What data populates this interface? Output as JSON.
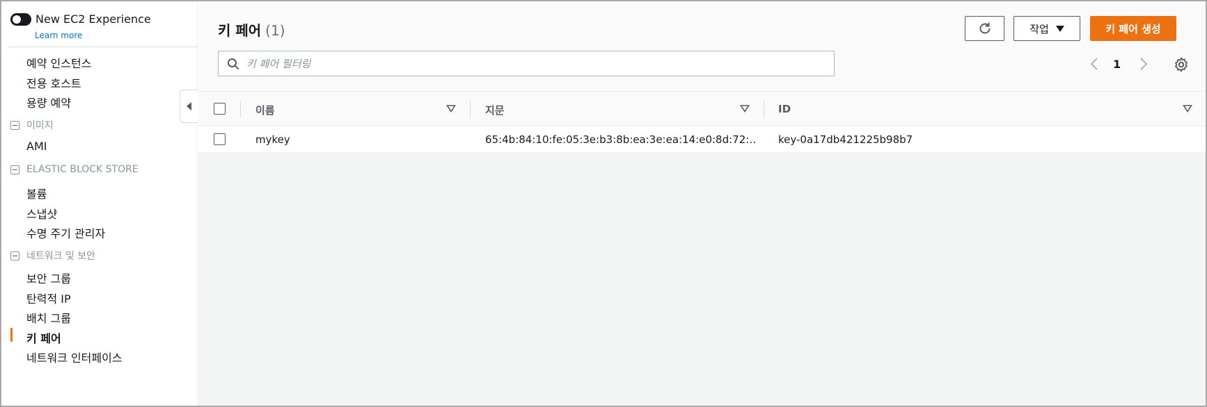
{
  "sidebar": {
    "toggle_label": "New EC2 Experience",
    "learn_more": "Learn more",
    "items_top": [
      "예약 인스턴스",
      "전용 호스트",
      "용량 예약"
    ],
    "section_images": "이미지",
    "images_items": [
      "AMI"
    ],
    "section_ebs": "ELASTIC BLOCK STORE",
    "ebs_items": [
      "볼륨",
      "스냅샷",
      "수명 주기 관리자"
    ],
    "section_network": "네트워크 및 보안",
    "network_items": [
      "보안 그룹",
      "탄력적 IP",
      "배치 그룹",
      "키 페어",
      "네트워크 인터페이스"
    ],
    "active_item": "키 페어"
  },
  "header": {
    "title": "키 페어",
    "count": "(1)",
    "actions_label": "작업",
    "create_label": "키 페어 생성",
    "accent_color": "#ec7211"
  },
  "search": {
    "placeholder": "키 페어 필터링",
    "value": ""
  },
  "pagination": {
    "current_page": "1"
  },
  "table": {
    "columns": [
      "이름",
      "지문",
      "ID"
    ],
    "rows": [
      {
        "name": "mykey",
        "fingerprint": "65:4b:84:10:fe:05:3e:b3:8b:ea:3e:ea:14:e0:8d:72:…",
        "id": "key-0a17db421225b98b7"
      }
    ]
  },
  "icons": [
    "toggle-icon",
    "collapse-icon",
    "refresh-icon",
    "caret-down-icon",
    "search-icon",
    "chevron-left-icon",
    "chevron-right-icon",
    "gear-icon",
    "sort-icon"
  ]
}
